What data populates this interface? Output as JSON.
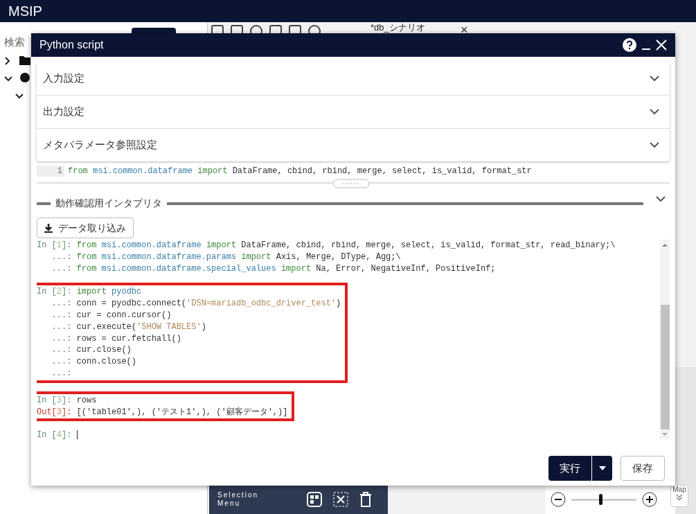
{
  "app": {
    "title": "MSIP",
    "search_label": "検索",
    "tab": {
      "label": "*db_シナリオ",
      "close": "×"
    },
    "selection_menu": {
      "lines": [
        "Selection",
        "Menu"
      ]
    },
    "map_button": "Map",
    "zoom": {
      "level": 0.45
    }
  },
  "dialog": {
    "title": "Python script",
    "sections": [
      {
        "label": "入力設定",
        "expanded": false
      },
      {
        "label": "出力設定",
        "expanded": false
      },
      {
        "label": "メタパラメータ参照設定",
        "expanded": false
      }
    ],
    "editor": {
      "line_number": "1",
      "tokens": [
        {
          "kind": "kw",
          "t": "from"
        },
        {
          "kind": "mod",
          "t": " msi.common.dataframe "
        },
        {
          "kind": "kw",
          "t": "import"
        },
        {
          "kind": "plain",
          "t": " DataFrame, cbind, rbind, merge, select, is_valid, format_str"
        }
      ]
    },
    "interpreter": {
      "title": "動作確認用インタプリタ",
      "import_button": "データ取り込み",
      "cells": [
        {
          "highlighted": false,
          "lines": [
            [
              {
                "kind": "prompt",
                "t": "In ["
              },
              {
                "kind": "num",
                "t": "1"
              },
              {
                "kind": "prompt",
                "t": "]: "
              },
              {
                "kind": "kw",
                "t": "from"
              },
              {
                "kind": "mod",
                "t": " msi.common.dataframe "
              },
              {
                "kind": "kw",
                "t": "import"
              },
              {
                "kind": "plain",
                "t": " DataFrame, cbind, rbind, merge, select, is_valid, format_str, read_binary;\\"
              }
            ],
            [
              {
                "kind": "prompt",
                "t": "   ...: "
              },
              {
                "kind": "kw",
                "t": "from"
              },
              {
                "kind": "mod",
                "t": " msi.common.dataframe.params "
              },
              {
                "kind": "kw",
                "t": "import"
              },
              {
                "kind": "plain",
                "t": " Axis, Merge, DType, Agg;\\"
              }
            ],
            [
              {
                "kind": "prompt",
                "t": "   ...: "
              },
              {
                "kind": "kw",
                "t": "from"
              },
              {
                "kind": "mod",
                "t": " msi.common.dataframe.special_values "
              },
              {
                "kind": "kw",
                "t": "import"
              },
              {
                "kind": "plain",
                "t": " Na, Error, NegativeInf, PositiveInf;"
              }
            ]
          ]
        },
        {
          "highlighted": true,
          "lines": [
            [
              {
                "kind": "prompt",
                "t": "In ["
              },
              {
                "kind": "num",
                "t": "2"
              },
              {
                "kind": "prompt",
                "t": "]: "
              },
              {
                "kind": "kw",
                "t": "import"
              },
              {
                "kind": "mod",
                "t": " pyodbc"
              }
            ],
            [
              {
                "kind": "prompt",
                "t": "   ...: "
              },
              {
                "kind": "plain",
                "t": "conn = pyodbc.connect("
              },
              {
                "kind": "str",
                "t": "'DSN=mariadb_odbc_driver_test'"
              },
              {
                "kind": "plain",
                "t": ")"
              }
            ],
            [
              {
                "kind": "prompt",
                "t": "   ...: "
              },
              {
                "kind": "plain",
                "t": "cur = conn.cursor()"
              }
            ],
            [
              {
                "kind": "prompt",
                "t": "   ...: "
              },
              {
                "kind": "plain",
                "t": "cur.execute("
              },
              {
                "kind": "str",
                "t": "'SHOW TABLES'"
              },
              {
                "kind": "plain",
                "t": ")"
              }
            ],
            [
              {
                "kind": "prompt",
                "t": "   ...: "
              },
              {
                "kind": "plain",
                "t": "rows = cur.fetchall()"
              }
            ],
            [
              {
                "kind": "prompt",
                "t": "   ...: "
              },
              {
                "kind": "plain",
                "t": "cur.close()"
              }
            ],
            [
              {
                "kind": "prompt",
                "t": "   ...: "
              },
              {
                "kind": "plain",
                "t": "conn.close()"
              }
            ],
            [
              {
                "kind": "prompt",
                "t": "   ...:"
              }
            ]
          ]
        },
        {
          "highlighted": true,
          "lines": [
            [
              {
                "kind": "prompt",
                "t": "In ["
              },
              {
                "kind": "num",
                "t": "3"
              },
              {
                "kind": "prompt",
                "t": "]: "
              },
              {
                "kind": "plain",
                "t": "rows"
              }
            ],
            [
              {
                "kind": "out",
                "t": "Out["
              },
              {
                "kind": "outnum",
                "t": "3"
              },
              {
                "kind": "out",
                "t": "]: "
              },
              {
                "kind": "plain",
                "t": "[('table01',), ('テスト1',), ('顧客データ',)]"
              }
            ]
          ]
        },
        {
          "highlighted": false,
          "cursor": true,
          "lines": [
            [
              {
                "kind": "prompt",
                "t": "In ["
              },
              {
                "kind": "num",
                "t": "4"
              },
              {
                "kind": "prompt",
                "t": "]: "
              }
            ]
          ]
        }
      ]
    },
    "run_button": "実行",
    "save_button": "保存"
  }
}
